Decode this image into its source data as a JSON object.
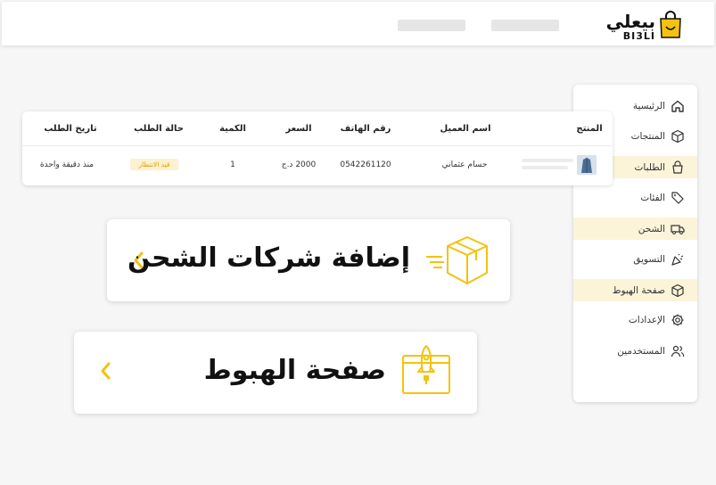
{
  "header": {
    "logo": {
      "arabic": "بيعلي",
      "latin": "BI3LI"
    },
    "accent_color": "#f4c20d"
  },
  "sidebar": {
    "items": [
      {
        "label": "الرئيسية",
        "icon": "home-icon"
      },
      {
        "label": "المنتجات",
        "icon": "box-icon"
      },
      {
        "label": "الطلبات",
        "icon": "shopping-bag-icon"
      },
      {
        "label": "الفئات",
        "icon": "tags-icon"
      },
      {
        "label": "الشحن",
        "icon": "truck-icon"
      },
      {
        "label": "التسويق",
        "icon": "party-icon"
      },
      {
        "label": "صفحة الهبوط",
        "icon": "cube-icon"
      },
      {
        "label": "الإعدادات",
        "icon": "gear-icon"
      },
      {
        "label": "المستخدمين",
        "icon": "users-icon"
      }
    ]
  },
  "orders_table": {
    "columns": [
      "المنتج",
      "اسم العميل",
      "رقم الهاتف",
      "السعر",
      "الكمية",
      "حالة الطلب",
      "تاريخ الطلب"
    ],
    "rows": [
      {
        "customer": "حسام عثماني",
        "phone": "0542261120",
        "price": "2000 د.ج",
        "quantity": "1",
        "status": "قيد الانتظار",
        "date": "منذ دقيقة واحدة"
      }
    ]
  },
  "cards": {
    "shipping": {
      "title": "إضافة شركات الشحن",
      "icon": "shipping-box-icon"
    },
    "landing": {
      "title": "صفحة الهبوط",
      "icon": "rocket-browser-icon"
    }
  }
}
